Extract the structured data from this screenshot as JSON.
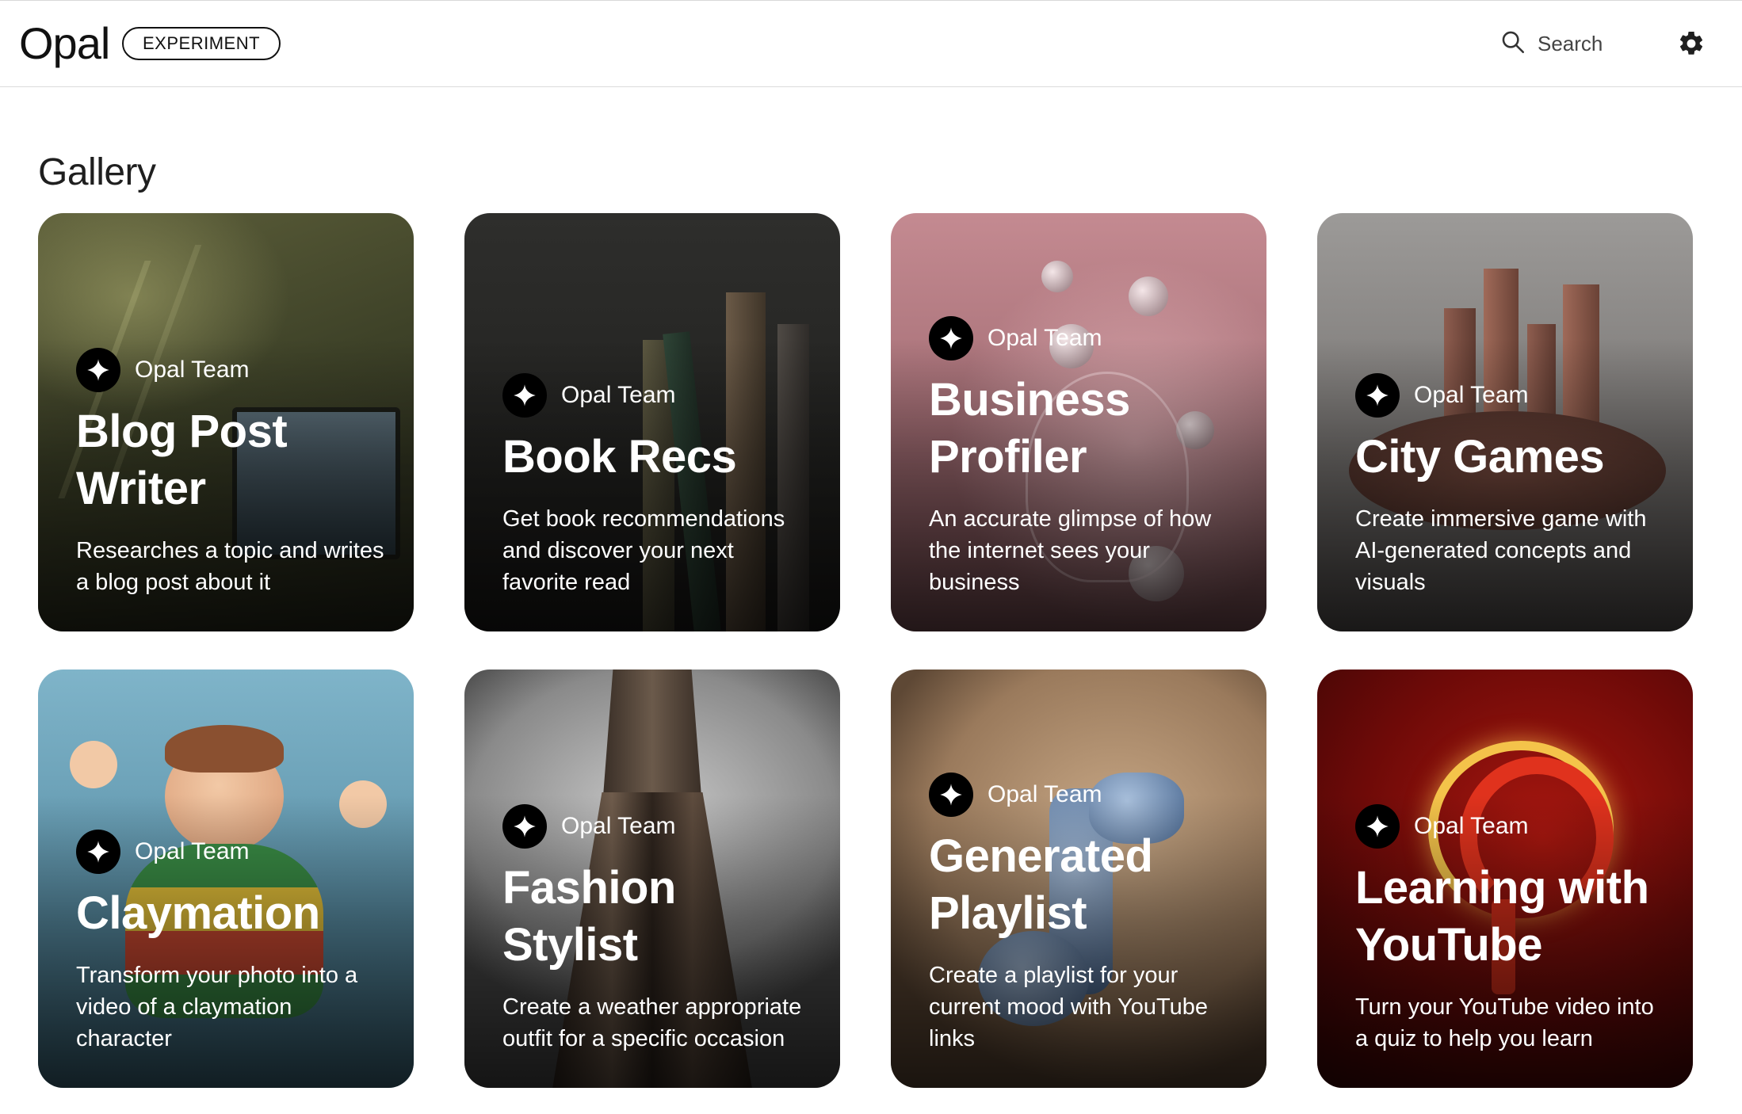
{
  "header": {
    "logo": "Opal",
    "badge": "EXPERIMENT",
    "search_label": "Search",
    "search_icon": "search-icon",
    "settings_icon": "gear-icon"
  },
  "page": {
    "title": "Gallery"
  },
  "cards": [
    {
      "author": "Opal Team",
      "title": "Blog Post Writer",
      "description": "Researches a topic and writes a blog post about it"
    },
    {
      "author": "Opal Team",
      "title": "Book Recs",
      "description": "Get book recommendations and discover your next favorite read"
    },
    {
      "author": "Opal Team",
      "title": "Business Profiler",
      "description": "An accurate glimpse of how the internet sees your business"
    },
    {
      "author": "Opal Team",
      "title": "City Games",
      "description": "Create immersive game with AI-generated concepts and visuals"
    },
    {
      "author": "Opal Team",
      "title": "Claymation",
      "description": "Transform your photo into a video of a claymation character"
    },
    {
      "author": "Opal Team",
      "title": "Fashion Stylist",
      "description": "Create a weather appropriate outfit for a specific occasion"
    },
    {
      "author": "Opal Team",
      "title": "Generated Playlist",
      "description": "Create a playlist for your current mood with YouTube links"
    },
    {
      "author": "Opal Team",
      "title": "Learning with YouTube",
      "description": "Turn your YouTube video into a quiz to help you learn"
    }
  ]
}
